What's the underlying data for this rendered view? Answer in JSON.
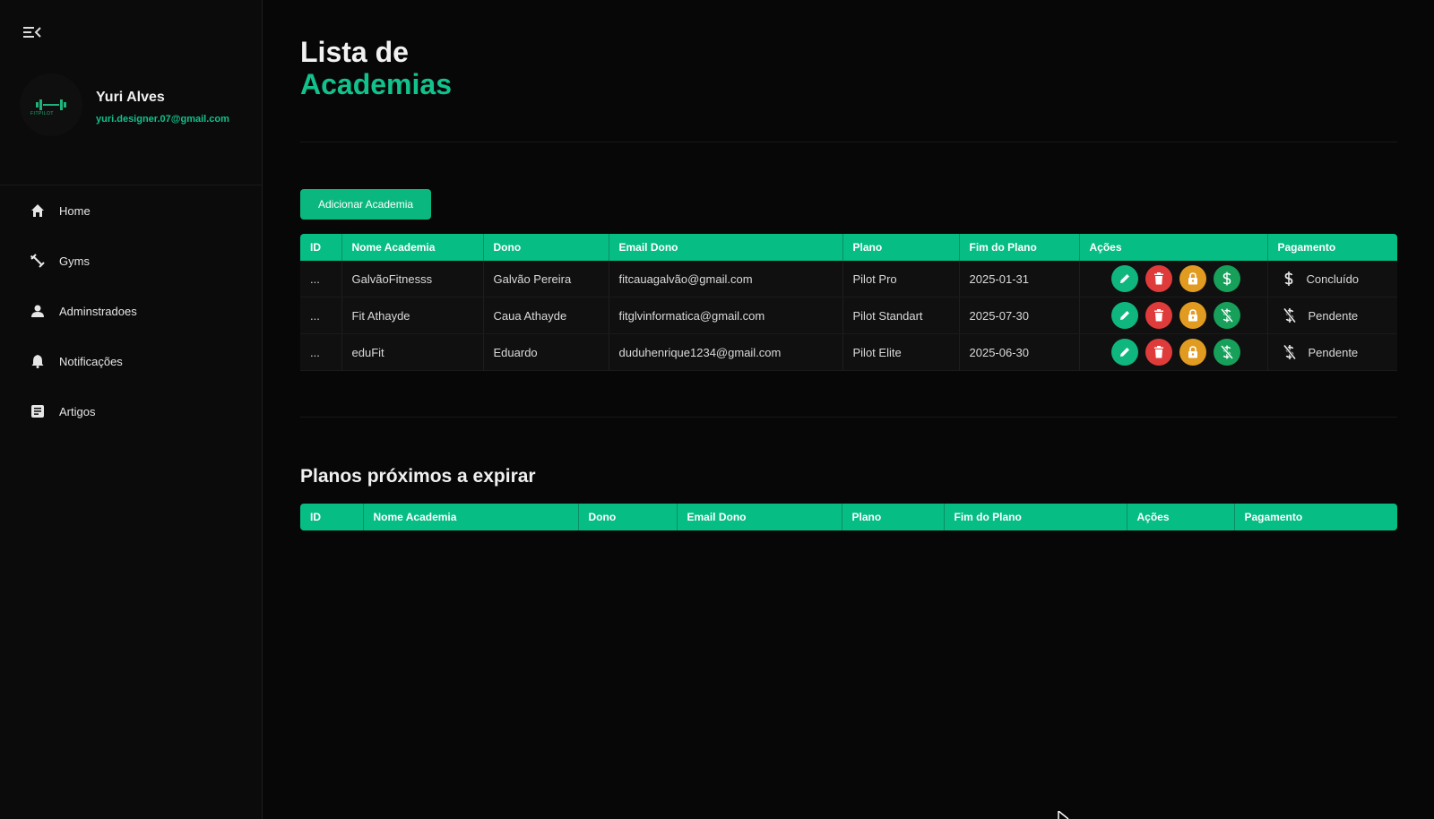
{
  "sidebar": {
    "logo_text": "FITPILOT",
    "profile": {
      "name": "Yuri Alves",
      "email": "yuri.designer.07@gmail.com"
    },
    "items": [
      {
        "label": "Home",
        "icon": "home-icon"
      },
      {
        "label": "Gyms",
        "icon": "dumbbell-icon"
      },
      {
        "label": "Adminstradoes",
        "icon": "user-icon"
      },
      {
        "label": "Notificações",
        "icon": "bell-icon"
      },
      {
        "label": "Artigos",
        "icon": "article-icon"
      }
    ]
  },
  "main": {
    "title_line1": "Lista de",
    "title_line2": "Academias",
    "add_button": "Adicionar Academia",
    "table": {
      "headers": [
        "ID",
        "Nome Academia",
        "Dono",
        "Email Dono",
        "Plano",
        "Fim do Plano",
        "Ações",
        "Pagamento"
      ],
      "rows": [
        {
          "id": "...",
          "nome": "GalvãoFitnesss",
          "dono": "Galvão Pereira",
          "email": "fitcauagalvão@gmail.com",
          "plano": "Pilot Pro",
          "fim": "2025-01-31",
          "pagamento": "Concluído",
          "pago": true
        },
        {
          "id": "...",
          "nome": "Fit Athayde",
          "dono": "Caua Athayde",
          "email": "fitglvinformatica@gmail.com",
          "plano": "Pilot Standart",
          "fim": "2025-07-30",
          "pagamento": "Pendente",
          "pago": false
        },
        {
          "id": "...",
          "nome": "eduFit",
          "dono": "Eduardo",
          "email": "duduhenrique1234@gmail.com",
          "plano": "Pilot Elite",
          "fim": "2025-06-30",
          "pagamento": "Pendente",
          "pago": false
        }
      ]
    },
    "section2_title": "Planos próximos a expirar",
    "table2": {
      "headers": [
        "ID",
        "Nome Academia",
        "Dono",
        "Email Dono",
        "Plano",
        "Fim do Plano",
        "Ações",
        "Pagamento"
      ]
    }
  },
  "colors": {
    "accent": "#06bd84",
    "background": "#070707",
    "edit": "#0fb77e",
    "delete": "#e03b3b",
    "lock": "#e29b21",
    "payment": "#16a05a"
  }
}
